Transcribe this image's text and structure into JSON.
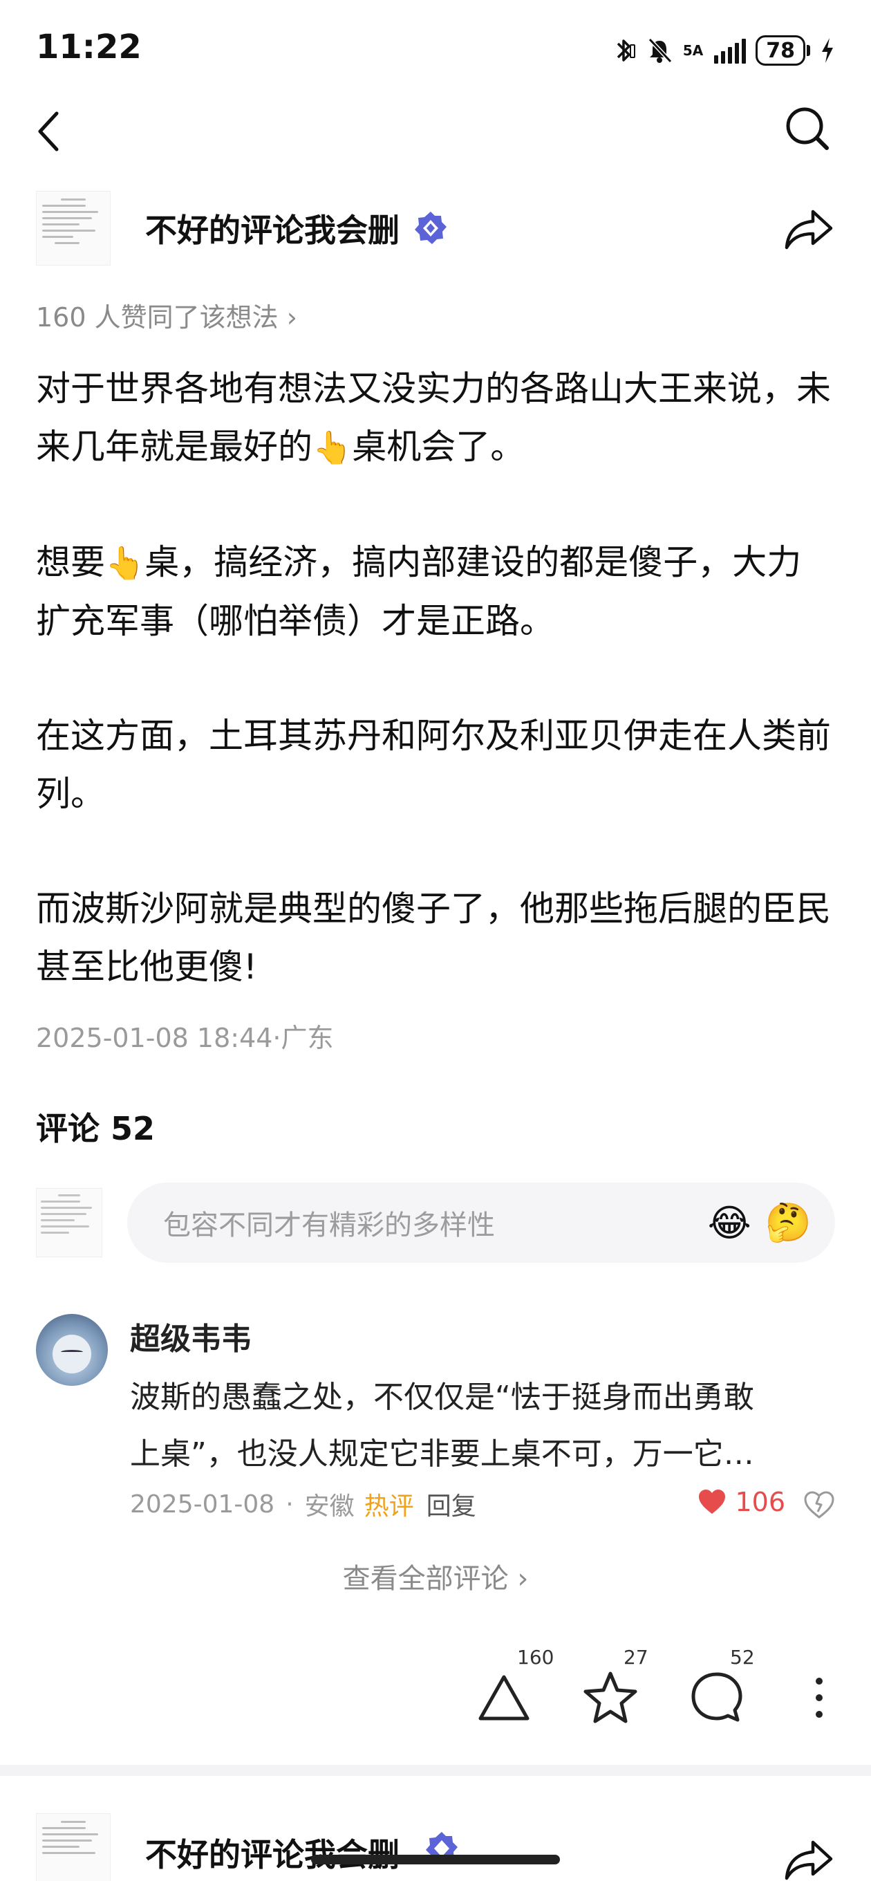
{
  "status_bar": {
    "time": "11:22",
    "network": "5A",
    "battery": "78"
  },
  "author": {
    "name": "不好的评论我会删"
  },
  "post": {
    "likes_line": "160 人赞同了该想法 ›",
    "paragraphs": [
      [
        "对于世界各地有想法又没实力的各路山大王来说，未来几年就是最好的",
        "👆",
        "桌机会了。"
      ],
      [
        "想要",
        "👆",
        "桌，搞经济，搞内部建设的都是傻子，大力扩充军事（哪怕举债）才是正路。"
      ],
      [
        "在这方面，土耳其苏丹和阿尔及利亚贝伊走在人类前列。"
      ],
      [
        "而波斯沙阿就是典型的傻子了，他那些拖后腿的臣民甚至比他更傻!"
      ]
    ],
    "meta": "2025-01-08 18:44·广东"
  },
  "comments": {
    "title": "评论 52",
    "input_placeholder": "包容不同才有精彩的多样性",
    "emoji_1": "😂",
    "emoji_2": "🤔",
    "items": [
      {
        "author": "超级韦韦",
        "text_line_1": "波斯的愚蠢之处，不仅仅是“怯于挺身而出勇敢",
        "text_line_2": "上桌”，也没人规定它非要上桌不可，万一它…",
        "date": "2025-01-08",
        "separator": "·",
        "location": "安徽",
        "hot_label": "热评",
        "reply_label": "回复",
        "like_count": "106"
      }
    ],
    "view_all": "查看全部评论 ›"
  },
  "actions": {
    "upvote_count": "160",
    "favorite_count": "27",
    "comment_count": "52"
  },
  "next_post": {
    "author_name": "不好的评论我会删"
  },
  "colors": {
    "accent_like": "#e74c4c",
    "hot_label": "#f0a21a",
    "verify_badge": "#5b63d6"
  }
}
